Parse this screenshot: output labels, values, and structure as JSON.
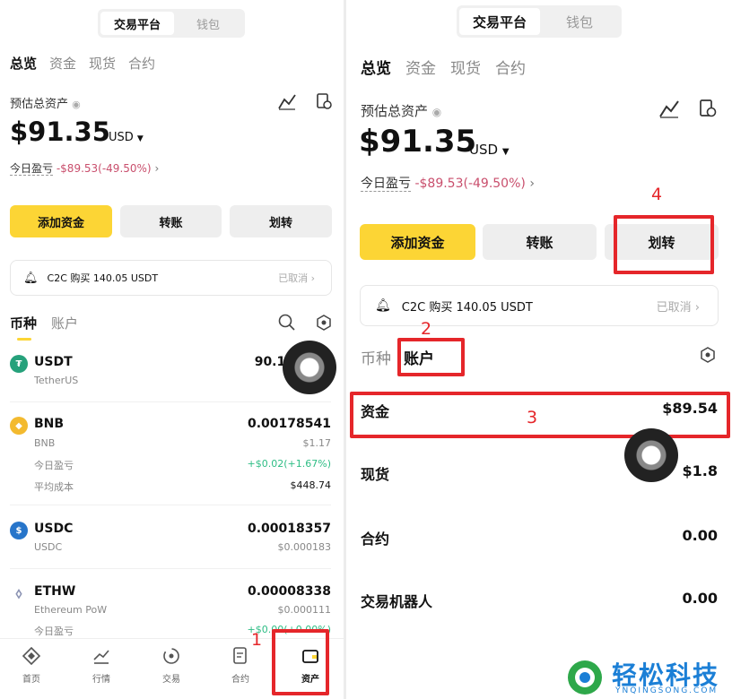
{
  "left": {
    "segment": [
      "交易平台",
      "钱包"
    ],
    "tabs": [
      "总览",
      "资金",
      "现货",
      "合约"
    ],
    "est_label": "预估总资产",
    "balance": "$91.35",
    "currency": "USD",
    "pnl_label": "今日盈亏",
    "pnl_value": "-$89.53(-49.50%)",
    "buttons": [
      "添加资金",
      "转账",
      "划转"
    ],
    "notice_text": "C2C 购买 140.05 USDT",
    "notice_status": "已取消",
    "list_tabs": [
      "币种",
      "账户"
    ],
    "coins": [
      {
        "symbol": "USDT",
        "name": "TetherUS",
        "amount": "90.18",
        "color": "#26a17b"
      },
      {
        "symbol": "BNB",
        "name": "BNB",
        "amount": "0.00178541",
        "value": "$1.17",
        "color": "#f3ba2f",
        "pnl_label": "今日盈亏",
        "pnl": "+$0.02(+1.67%)",
        "cost_label": "平均成本",
        "cost": "$448.74"
      },
      {
        "symbol": "USDC",
        "name": "USDC",
        "amount": "0.00018357",
        "value": "$0.000183",
        "color": "#2775ca"
      },
      {
        "symbol": "ETHW",
        "name": "Ethereum PoW",
        "amount": "0.00008338",
        "value": "$0.000111",
        "color": "#8a92b2",
        "pnl_label": "今日盈亏",
        "pnl": "+$0.00(+0.00%)"
      }
    ],
    "nav": [
      "首页",
      "行情",
      "交易",
      "合约",
      "资产"
    ],
    "annot_1": "1"
  },
  "right": {
    "segment": [
      "交易平台",
      "钱包"
    ],
    "tabs": [
      "总览",
      "资金",
      "现货",
      "合约"
    ],
    "est_label": "预估总资产",
    "balance": "$91.35",
    "currency": "USD",
    "pnl_label": "今日盈亏",
    "pnl_value": "-$89.53(-49.50%)",
    "buttons": [
      "添加资金",
      "转账",
      "划转"
    ],
    "notice_text": "C2C 购买 140.05 USDT",
    "notice_status": "已取消",
    "list_tabs": [
      "币种",
      "账户"
    ],
    "accounts": [
      {
        "name": "资金",
        "value": "$89.54"
      },
      {
        "name": "现货",
        "value": "$1.8"
      },
      {
        "name": "合约",
        "value": "0.00"
      },
      {
        "name": "交易机器人",
        "value": "0.00"
      }
    ],
    "annot_2": "2",
    "annot_3": "3",
    "annot_4": "4"
  },
  "watermark": {
    "title": "轻松科技",
    "url": "YNQINGSONG.COM",
    "color_blue": "#1b7fd6",
    "color_green": "#2ea84a"
  }
}
